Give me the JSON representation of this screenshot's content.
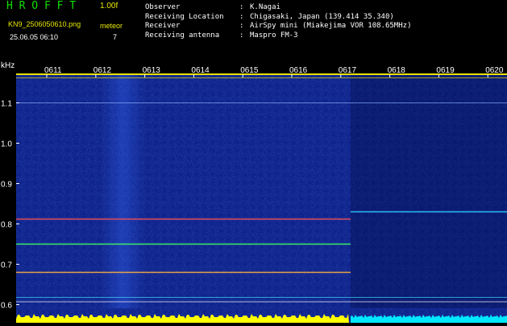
{
  "header": {
    "app_title": "H R O F F T",
    "version": "1.00f",
    "filename": "KN9_2506050610.png",
    "datetime": "25.06.05 06:10",
    "meteor_label": "meteor",
    "meteor_count": "7"
  },
  "info": [
    {
      "key": "Observer",
      "sep": ":",
      "value": "K.Nagai"
    },
    {
      "key": "Receiving Location",
      "sep": ":",
      "value": "Chigasaki, Japan (139.414 35.340)"
    },
    {
      "key": "Receiver",
      "sep": ":",
      "value": "AirSpy mini (Miakejima VOR 108.65MHz)"
    },
    {
      "key": "Receiving antenna",
      "sep": ":",
      "value": "Maspro FM-3"
    }
  ],
  "spectrogram": {
    "unit_label": "kHz",
    "y_ticks": [
      "1.1",
      "1.0",
      "0.9",
      "0.8",
      "0.7",
      "0.6"
    ],
    "y_tick_values": [
      1.1,
      1.0,
      0.9,
      0.8,
      0.7,
      0.6
    ],
    "time_labels": [
      "0611",
      "0612",
      "0613",
      "0614",
      "0615",
      "0616",
      "0617",
      "0618",
      "0619",
      "0620"
    ],
    "carrier_lines_khz": [
      1.162,
      1.1,
      0.83,
      0.812,
      0.75,
      0.68,
      0.618,
      0.607
    ],
    "colors": {
      "background": "#0a1a7a",
      "grid_text": "#ffffff",
      "level_before": "#ffff00",
      "level_after": "#00e8ff"
    }
  }
}
